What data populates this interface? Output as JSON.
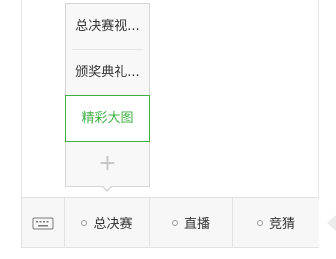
{
  "submenu": {
    "items": [
      {
        "label": "总决赛视..."
      },
      {
        "label": "颁奖典礼..."
      },
      {
        "label": "精彩大图"
      }
    ],
    "add_label": "+"
  },
  "menubar": {
    "keyboard_icon": "keyboard-icon",
    "items": [
      {
        "label": "总决赛"
      },
      {
        "label": "直播"
      },
      {
        "label": "竞猜"
      }
    ]
  },
  "colors": {
    "accent": "#3fb144",
    "border": "#d5d5d5",
    "bar_bg": "#f7f7f7"
  }
}
